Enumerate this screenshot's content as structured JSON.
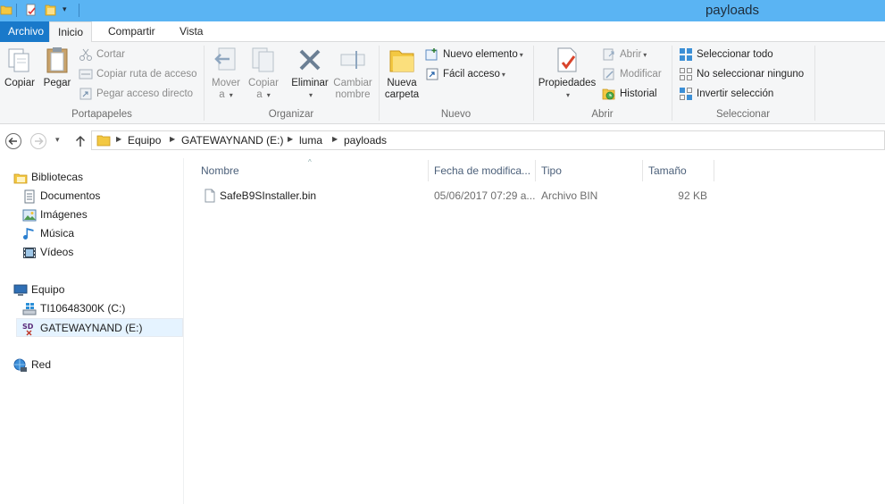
{
  "window": {
    "title": "payloads"
  },
  "quick_access": {
    "icons": [
      "folder-icon",
      "properties-icon",
      "new-folder-icon",
      "customize-caret-icon"
    ]
  },
  "tabs": [
    {
      "label": "Archivo"
    },
    {
      "label": "Inicio"
    },
    {
      "label": "Compartir"
    },
    {
      "label": "Vista"
    }
  ],
  "ribbon": {
    "portapapeles": {
      "label": "Portapapeles",
      "copiar": "Copiar",
      "pegar": "Pegar",
      "cortar": "Cortar",
      "copiar_ruta": "Copiar ruta de acceso",
      "pegar_acceso": "Pegar acceso directo"
    },
    "organizar": {
      "label": "Organizar",
      "mover_a": [
        "Mover",
        "a"
      ],
      "copiar_a": [
        "Copiar",
        "a"
      ],
      "eliminar": "Eliminar",
      "cambiar_nombre": [
        "Cambiar",
        "nombre"
      ]
    },
    "nuevo": {
      "label": "Nuevo",
      "nueva_carpeta": [
        "Nueva",
        "carpeta"
      ],
      "nuevo_elemento": "Nuevo elemento",
      "facil_acceso": "Fácil acceso"
    },
    "abrir": {
      "label": "Abrir",
      "propiedades": "Propiedades",
      "abrir": "Abrir",
      "modificar": "Modificar",
      "historial": "Historial"
    },
    "seleccionar": {
      "label": "Seleccionar",
      "todo": "Seleccionar todo",
      "ninguno": "No seleccionar ninguno",
      "invertir": "Invertir selección"
    }
  },
  "address": {
    "crumbs": [
      "Equipo",
      "GATEWAYNAND (E:)",
      "luma",
      "payloads"
    ]
  },
  "navpane": {
    "bibliotecas": "Bibliotecas",
    "documentos": "Documentos",
    "imagenes": "Imágenes",
    "musica": "Música",
    "videos": "Vídeos",
    "equipo": "Equipo",
    "drive_c": "TI10648300K (C:)",
    "drive_e": "GATEWAYNAND (E:)",
    "red": "Red"
  },
  "filelist": {
    "columns": [
      "Nombre",
      "Fecha de modifica...",
      "Tipo",
      "Tamaño"
    ],
    "rows": [
      {
        "name": "SafeB9SInstaller.bin",
        "date": "05/06/2017 07:29 a...",
        "type": "Archivo BIN",
        "size": "92 KB"
      }
    ]
  },
  "colors": {
    "titlebar": "#5ab4f3",
    "file_tab": "#1979ca",
    "ribbon_bg": "#f5f6f7",
    "selection": "#e5f3ff"
  }
}
